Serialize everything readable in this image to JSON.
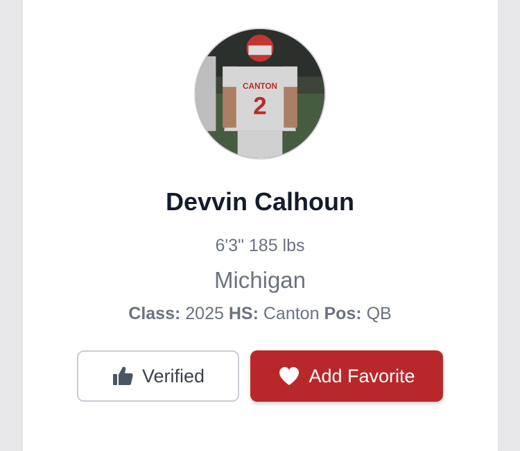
{
  "profile": {
    "name": "Devvin Calhoun",
    "height_weight": "6'3\" 185 lbs",
    "state": "Michigan",
    "class_label": "Class:",
    "class_value": "2025",
    "hs_label": "HS:",
    "hs_value": "Canton",
    "pos_label": "Pos:",
    "pos_value": "QB",
    "jersey_team": "CANTON",
    "jersey_number": "2"
  },
  "actions": {
    "verified_label": "Verified",
    "verified_icon": "thumbs-up-icon",
    "favorite_label": "Add Favorite",
    "favorite_icon": "heart-icon"
  },
  "colors": {
    "favorite_bg": "#b8282b",
    "name_text": "#141b2b",
    "muted_text": "#6b7280"
  }
}
